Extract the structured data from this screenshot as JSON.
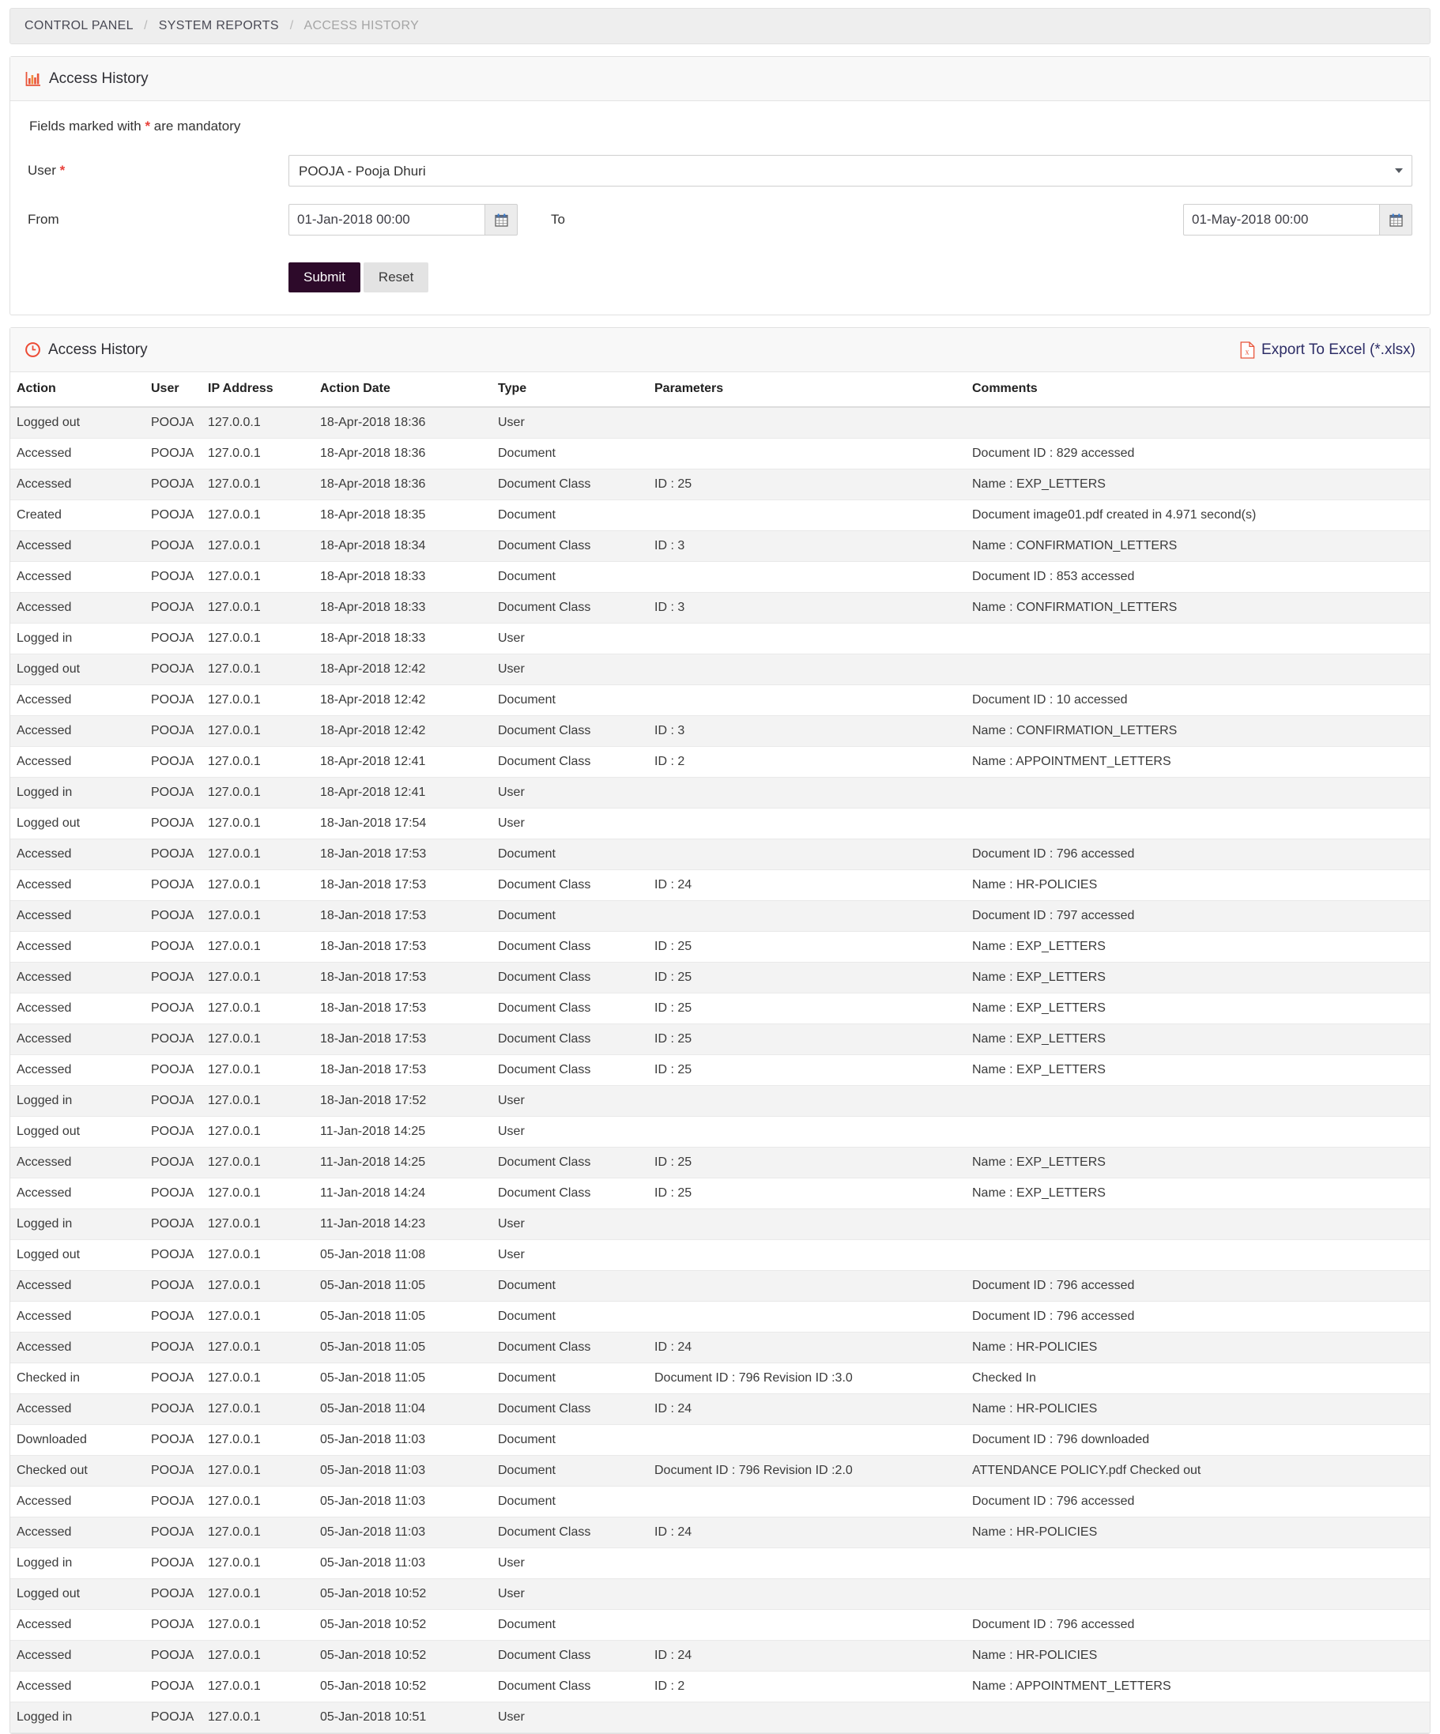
{
  "breadcrumb": {
    "items": [
      "CONTROL PANEL",
      "SYSTEM REPORTS",
      "ACCESS HISTORY"
    ],
    "separator": "/"
  },
  "form_panel": {
    "title": "Access History",
    "icon": "bar-chart-icon",
    "mandatory_note_prefix": "Fields marked with ",
    "mandatory_marker": "*",
    "mandatory_note_suffix": " are mandatory",
    "user_label": "User",
    "user_required_marker": "*",
    "user_value": "POOJA - Pooja Dhuri",
    "from_label": "From",
    "from_value": "01-Jan-2018 00:00",
    "to_label": "To",
    "to_value": "01-May-2018 00:00",
    "submit_label": "Submit",
    "reset_label": "Reset",
    "submit_color": "#2d0a2a"
  },
  "results_panel": {
    "title": "Access History",
    "icon": "clock-icon",
    "export_label": "Export To Excel (*.xlsx)",
    "export_icon": "excel-file-icon",
    "columns": [
      "Action",
      "User",
      "IP Address",
      "Action Date",
      "Type",
      "Parameters",
      "Comments"
    ],
    "rows": [
      [
        "Logged out",
        "POOJA",
        "127.0.0.1",
        "18-Apr-2018 18:36",
        "User",
        "",
        ""
      ],
      [
        "Accessed",
        "POOJA",
        "127.0.0.1",
        "18-Apr-2018 18:36",
        "Document",
        "",
        "Document ID : 829 accessed"
      ],
      [
        "Accessed",
        "POOJA",
        "127.0.0.1",
        "18-Apr-2018 18:36",
        "Document Class",
        "ID : 25",
        "Name : EXP_LETTERS"
      ],
      [
        "Created",
        "POOJA",
        "127.0.0.1",
        "18-Apr-2018 18:35",
        "Document",
        "",
        "Document image01.pdf created in 4.971 second(s)"
      ],
      [
        "Accessed",
        "POOJA",
        "127.0.0.1",
        "18-Apr-2018 18:34",
        "Document Class",
        "ID : 3",
        "Name : CONFIRMATION_LETTERS"
      ],
      [
        "Accessed",
        "POOJA",
        "127.0.0.1",
        "18-Apr-2018 18:33",
        "Document",
        "",
        "Document ID : 853 accessed"
      ],
      [
        "Accessed",
        "POOJA",
        "127.0.0.1",
        "18-Apr-2018 18:33",
        "Document Class",
        "ID : 3",
        "Name : CONFIRMATION_LETTERS"
      ],
      [
        "Logged in",
        "POOJA",
        "127.0.0.1",
        "18-Apr-2018 18:33",
        "User",
        "",
        ""
      ],
      [
        "Logged out",
        "POOJA",
        "127.0.0.1",
        "18-Apr-2018 12:42",
        "User",
        "",
        ""
      ],
      [
        "Accessed",
        "POOJA",
        "127.0.0.1",
        "18-Apr-2018 12:42",
        "Document",
        "",
        "Document ID : 10 accessed"
      ],
      [
        "Accessed",
        "POOJA",
        "127.0.0.1",
        "18-Apr-2018 12:42",
        "Document Class",
        "ID : 3",
        "Name : CONFIRMATION_LETTERS"
      ],
      [
        "Accessed",
        "POOJA",
        "127.0.0.1",
        "18-Apr-2018 12:41",
        "Document Class",
        "ID : 2",
        "Name : APPOINTMENT_LETTERS"
      ],
      [
        "Logged in",
        "POOJA",
        "127.0.0.1",
        "18-Apr-2018 12:41",
        "User",
        "",
        ""
      ],
      [
        "Logged out",
        "POOJA",
        "127.0.0.1",
        "18-Jan-2018 17:54",
        "User",
        "",
        ""
      ],
      [
        "Accessed",
        "POOJA",
        "127.0.0.1",
        "18-Jan-2018 17:53",
        "Document",
        "",
        "Document ID : 796 accessed"
      ],
      [
        "Accessed",
        "POOJA",
        "127.0.0.1",
        "18-Jan-2018 17:53",
        "Document Class",
        "ID : 24",
        "Name : HR-POLICIES"
      ],
      [
        "Accessed",
        "POOJA",
        "127.0.0.1",
        "18-Jan-2018 17:53",
        "Document",
        "",
        "Document ID : 797 accessed"
      ],
      [
        "Accessed",
        "POOJA",
        "127.0.0.1",
        "18-Jan-2018 17:53",
        "Document Class",
        "ID : 25",
        "Name : EXP_LETTERS"
      ],
      [
        "Accessed",
        "POOJA",
        "127.0.0.1",
        "18-Jan-2018 17:53",
        "Document Class",
        "ID : 25",
        "Name : EXP_LETTERS"
      ],
      [
        "Accessed",
        "POOJA",
        "127.0.0.1",
        "18-Jan-2018 17:53",
        "Document Class",
        "ID : 25",
        "Name : EXP_LETTERS"
      ],
      [
        "Accessed",
        "POOJA",
        "127.0.0.1",
        "18-Jan-2018 17:53",
        "Document Class",
        "ID : 25",
        "Name : EXP_LETTERS"
      ],
      [
        "Accessed",
        "POOJA",
        "127.0.0.1",
        "18-Jan-2018 17:53",
        "Document Class",
        "ID : 25",
        "Name : EXP_LETTERS"
      ],
      [
        "Logged in",
        "POOJA",
        "127.0.0.1",
        "18-Jan-2018 17:52",
        "User",
        "",
        ""
      ],
      [
        "Logged out",
        "POOJA",
        "127.0.0.1",
        "11-Jan-2018 14:25",
        "User",
        "",
        ""
      ],
      [
        "Accessed",
        "POOJA",
        "127.0.0.1",
        "11-Jan-2018 14:25",
        "Document Class",
        "ID : 25",
        "Name : EXP_LETTERS"
      ],
      [
        "Accessed",
        "POOJA",
        "127.0.0.1",
        "11-Jan-2018 14:24",
        "Document Class",
        "ID : 25",
        "Name : EXP_LETTERS"
      ],
      [
        "Logged in",
        "POOJA",
        "127.0.0.1",
        "11-Jan-2018 14:23",
        "User",
        "",
        ""
      ],
      [
        "Logged out",
        "POOJA",
        "127.0.0.1",
        "05-Jan-2018 11:08",
        "User",
        "",
        ""
      ],
      [
        "Accessed",
        "POOJA",
        "127.0.0.1",
        "05-Jan-2018 11:05",
        "Document",
        "",
        "Document ID : 796 accessed"
      ],
      [
        "Accessed",
        "POOJA",
        "127.0.0.1",
        "05-Jan-2018 11:05",
        "Document",
        "",
        "Document ID : 796 accessed"
      ],
      [
        "Accessed",
        "POOJA",
        "127.0.0.1",
        "05-Jan-2018 11:05",
        "Document Class",
        "ID : 24",
        "Name : HR-POLICIES"
      ],
      [
        "Checked in",
        "POOJA",
        "127.0.0.1",
        "05-Jan-2018 11:05",
        "Document",
        "Document ID : 796 Revision ID :3.0",
        "Checked In"
      ],
      [
        "Accessed",
        "POOJA",
        "127.0.0.1",
        "05-Jan-2018 11:04",
        "Document Class",
        "ID : 24",
        "Name : HR-POLICIES"
      ],
      [
        "Downloaded",
        "POOJA",
        "127.0.0.1",
        "05-Jan-2018 11:03",
        "Document",
        "",
        "Document ID : 796 downloaded"
      ],
      [
        "Checked out",
        "POOJA",
        "127.0.0.1",
        "05-Jan-2018 11:03",
        "Document",
        "Document ID : 796 Revision ID :2.0",
        "ATTENDANCE POLICY.pdf Checked out"
      ],
      [
        "Accessed",
        "POOJA",
        "127.0.0.1",
        "05-Jan-2018 11:03",
        "Document",
        "",
        "Document ID : 796 accessed"
      ],
      [
        "Accessed",
        "POOJA",
        "127.0.0.1",
        "05-Jan-2018 11:03",
        "Document Class",
        "ID : 24",
        "Name : HR-POLICIES"
      ],
      [
        "Logged in",
        "POOJA",
        "127.0.0.1",
        "05-Jan-2018 11:03",
        "User",
        "",
        ""
      ],
      [
        "Logged out",
        "POOJA",
        "127.0.0.1",
        "05-Jan-2018 10:52",
        "User",
        "",
        ""
      ],
      [
        "Accessed",
        "POOJA",
        "127.0.0.1",
        "05-Jan-2018 10:52",
        "Document",
        "",
        "Document ID : 796 accessed"
      ],
      [
        "Accessed",
        "POOJA",
        "127.0.0.1",
        "05-Jan-2018 10:52",
        "Document Class",
        "ID : 24",
        "Name : HR-POLICIES"
      ],
      [
        "Accessed",
        "POOJA",
        "127.0.0.1",
        "05-Jan-2018 10:52",
        "Document Class",
        "ID : 2",
        "Name : APPOINTMENT_LETTERS"
      ],
      [
        "Logged in",
        "POOJA",
        "127.0.0.1",
        "05-Jan-2018 10:51",
        "User",
        "",
        ""
      ]
    ]
  }
}
